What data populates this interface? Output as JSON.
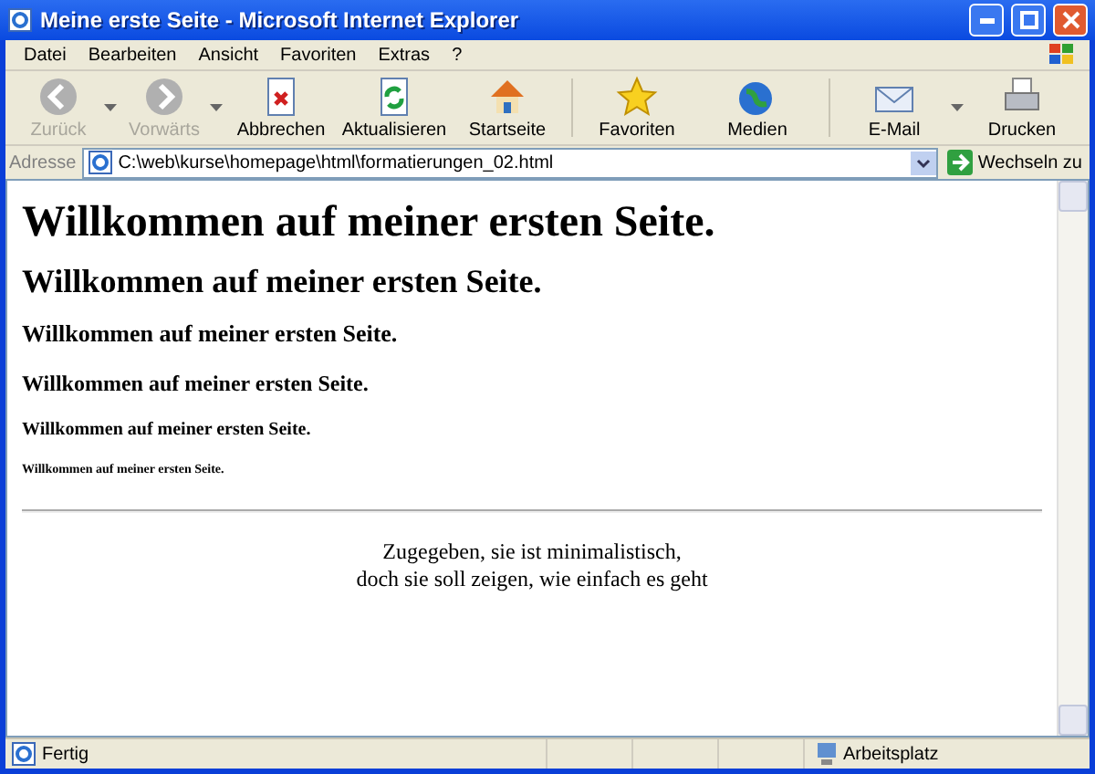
{
  "window": {
    "title": "Meine erste Seite - Microsoft Internet Explorer"
  },
  "menu": [
    "Datei",
    "Bearbeiten",
    "Ansicht",
    "Favoriten",
    "Extras",
    "?"
  ],
  "toolbar": [
    {
      "label": "Zurück",
      "kind": "back",
      "disabled": true,
      "dropdown": true
    },
    {
      "label": "Vorwärts",
      "kind": "forward",
      "disabled": true,
      "dropdown": true
    },
    {
      "label": "Abbrechen",
      "kind": "stop",
      "disabled": false,
      "dropdown": false
    },
    {
      "label": "Aktualisieren",
      "kind": "refresh",
      "disabled": false,
      "dropdown": false
    },
    {
      "label": "Startseite",
      "kind": "home",
      "disabled": false,
      "dropdown": false
    },
    {
      "label": "Favoriten",
      "kind": "favorites",
      "disabled": false,
      "dropdown": false
    },
    {
      "label": "Medien",
      "kind": "media",
      "disabled": false,
      "dropdown": false
    },
    {
      "label": "E-Mail",
      "kind": "mail",
      "disabled": false,
      "dropdown": true
    },
    {
      "label": "Drucken",
      "kind": "print",
      "disabled": false,
      "dropdown": false
    }
  ],
  "address": {
    "label": "Adresse",
    "value": "C:\\web\\kurse\\homepage\\html\\formatierungen_02.html",
    "go": "Wechseln zu"
  },
  "page": {
    "headings": [
      {
        "kind": "h1",
        "text": "Willkommen auf meiner ersten Seite."
      },
      {
        "kind": "h2",
        "text": "Willkommen auf meiner ersten Seite."
      },
      {
        "kind": "h3",
        "text": "Willkommen auf meiner ersten Seite."
      },
      {
        "kind": "h4",
        "text": "Willkommen auf meiner ersten Seite."
      },
      {
        "kind": "h5",
        "text": "Willkommen auf meiner ersten Seite."
      },
      {
        "kind": "h6",
        "text": "Willkommen auf meiner ersten Seite."
      }
    ],
    "paragraph": [
      "Zugegeben, sie ist minimalistisch,",
      "doch sie soll zeigen, wie einfach es geht"
    ]
  },
  "status_bar": {
    "status": "Fertig",
    "zone": "Arbeitsplatz"
  }
}
